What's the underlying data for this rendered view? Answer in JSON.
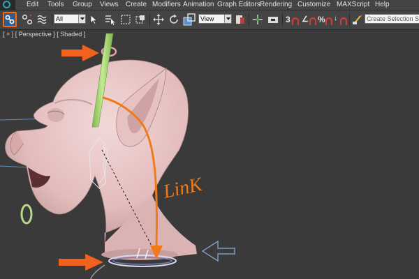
{
  "menu": [
    "Edit",
    "Tools",
    "Group",
    "Views",
    "Create",
    "Modifiers",
    "Animation",
    "Graph Editors",
    "Rendering",
    "Customize",
    "MAXScript",
    "Help"
  ],
  "toolbar": {
    "filter_value": "All",
    "coord_system_value": "View",
    "snap_label": "3",
    "angle_snap_label": "∠",
    "percent_snap_label": "%",
    "spinner_snap_label": "↓",
    "selection_set_placeholder": "Create Selection Se",
    "icons": [
      "select-and-link-icon",
      "unlink-icon",
      "bind-space-warp-icon",
      "select-object-icon",
      "select-by-name-icon",
      "rectangular-region-icon",
      "window-crossing-icon",
      "move-icon",
      "rotate-icon",
      "scale-icon",
      "pivot-icon",
      "manipulate-icon",
      "keyboard-shortcut-icon",
      "snap-icon",
      "angle-snap-icon",
      "percent-snap-icon",
      "spinner-snap-icon",
      "edit-named-selection-icon"
    ]
  },
  "viewport": {
    "label": "[ + ] [ Perspective ] [ Shaded ]",
    "annotation_text": "LinK"
  },
  "colors": {
    "ui_bg": "#444444",
    "viewport_bg": "#3a3a3a",
    "active_button": "#2c5e95",
    "highlight_orange": "#ff6a00",
    "annotation_orange": "#f07a1a",
    "skin": "#e7c4c4",
    "bone_green": "#a8d87a"
  }
}
